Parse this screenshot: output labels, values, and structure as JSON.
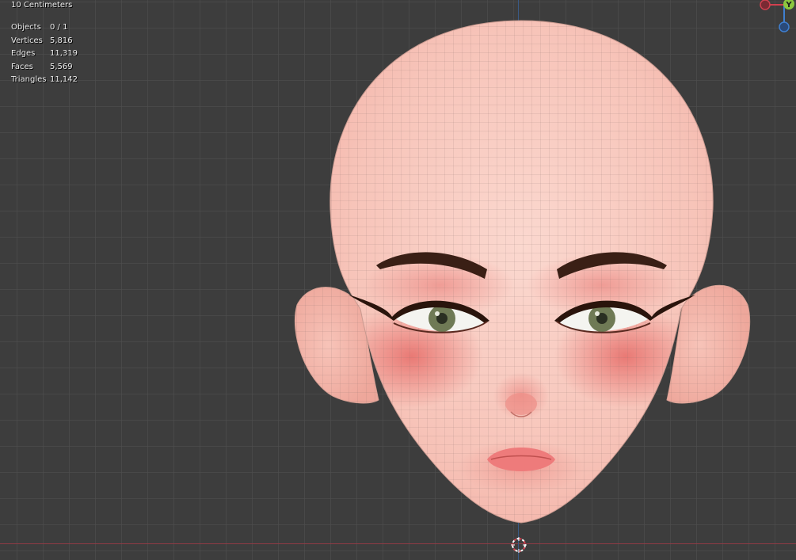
{
  "viewport": {
    "grid_scale_label": "10 Centimeters",
    "stats": [
      {
        "label": "Objects",
        "value": "0 / 1"
      },
      {
        "label": "Vertices",
        "value": "5,816"
      },
      {
        "label": "Edges",
        "value": "11,319"
      },
      {
        "label": "Faces",
        "value": "5,569"
      },
      {
        "label": "Triangles",
        "value": "11,142"
      }
    ]
  },
  "gizmo": {
    "y_label": "Y",
    "x_color": "#d0404f",
    "y_color": "#8cc63f",
    "z_color": "#3f7fd0"
  },
  "model": {
    "skin_color": "#f7c6bd",
    "blush_color": "#e8706c",
    "brow_color": "#3a1f15",
    "iris_color": "#6f7a55",
    "lip_color": "#ee7b7b",
    "wire_color": "#8a6f6b"
  }
}
